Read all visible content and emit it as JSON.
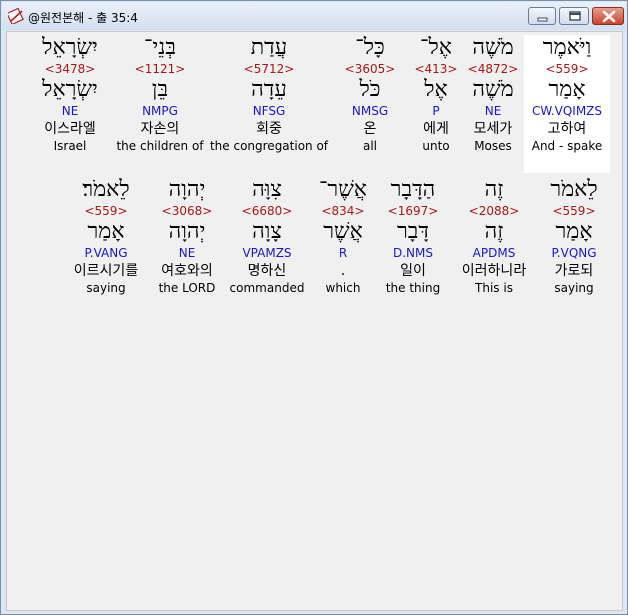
{
  "window": {
    "title": "@원전본해 - 출 35:4",
    "buttons": [
      "minimize",
      "maximize",
      "close"
    ]
  },
  "rows": [
    {
      "words": [
        {
          "hebrew": "יִשְׂרָאֵל",
          "strong": "<3478>",
          "lemma": "יִשְׂרָאֵל",
          "morph": "NE",
          "korean": "이스라엘",
          "english": "Israel",
          "highlighted": false
        },
        {
          "hebrew": "בְּנֵי־",
          "strong": "<1121>",
          "lemma": "בֵּן",
          "morph": "NMPG",
          "korean": "자손의",
          "english": "the children of",
          "highlighted": false
        },
        {
          "hebrew": "עֲדַת",
          "strong": "<5712>",
          "lemma": "עֵדָה",
          "morph": "NFSG",
          "korean": "회중",
          "english": "the congregation of",
          "highlighted": false
        },
        {
          "hebrew": "כָּל־",
          "strong": "<3605>",
          "lemma": "כֹּל",
          "morph": "NMSG",
          "korean": "온",
          "english": "all",
          "highlighted": false
        },
        {
          "hebrew": "אֶל־",
          "strong": "<413>",
          "lemma": "אֶל",
          "morph": "P",
          "korean": "에게",
          "english": "unto",
          "highlighted": false
        },
        {
          "hebrew": "מֹשֶׁה",
          "strong": "<4872>",
          "lemma": "מֹשֶׁה",
          "morph": "NE",
          "korean": "모세가",
          "english": "Moses",
          "highlighted": false
        },
        {
          "hebrew": "וַיֹּאמֶר",
          "strong": "<559>",
          "lemma": "אָמַר",
          "morph": "CW.VQIMZS",
          "korean": "고하여",
          "english": "And - spake",
          "highlighted": true
        }
      ]
    },
    {
      "words": [
        {
          "hebrew": "לֵאמֹר׃",
          "strong": "<559>",
          "lemma": "אָמַר",
          "morph": "P.VANG",
          "korean": "이르시기를",
          "english": "saying",
          "highlighted": false
        },
        {
          "hebrew": "יְהוָה",
          "strong": "<3068>",
          "lemma": "יְהוָה",
          "morph": "NE",
          "korean": "여호와의",
          "english": "the LORD",
          "highlighted": false
        },
        {
          "hebrew": "צִוָּה",
          "strong": "<6680>",
          "lemma": "צָוָה",
          "morph": "VPAMZS",
          "korean": "명하신",
          "english": "commanded",
          "highlighted": false
        },
        {
          "hebrew": "אֲשֶׁר־",
          "strong": "<834>",
          "lemma": "אֲשֶׁר",
          "morph": "R",
          "korean": ".",
          "english": "which",
          "highlighted": false
        },
        {
          "hebrew": "הַדָּבָר",
          "strong": "<1697>",
          "lemma": "דָּבָר",
          "morph": "D.NMS",
          "korean": "일이",
          "english": "the thing",
          "highlighted": false
        },
        {
          "hebrew": "זֶה",
          "strong": "<2088>",
          "lemma": "זֶה",
          "morph": "APDMS",
          "korean": "이러하니라",
          "english": "This is",
          "highlighted": false
        },
        {
          "hebrew": "לֵאמֹר",
          "strong": "<559>",
          "lemma": "אָמַר",
          "morph": "P.VQNG",
          "korean": "가로되",
          "english": "saying",
          "highlighted": false
        }
      ]
    }
  ],
  "colors": {
    "strong_number": "#a81818",
    "morphology": "#1818c8",
    "highlight_background": "#ffffff",
    "panel_background": "#f0f0f0"
  }
}
